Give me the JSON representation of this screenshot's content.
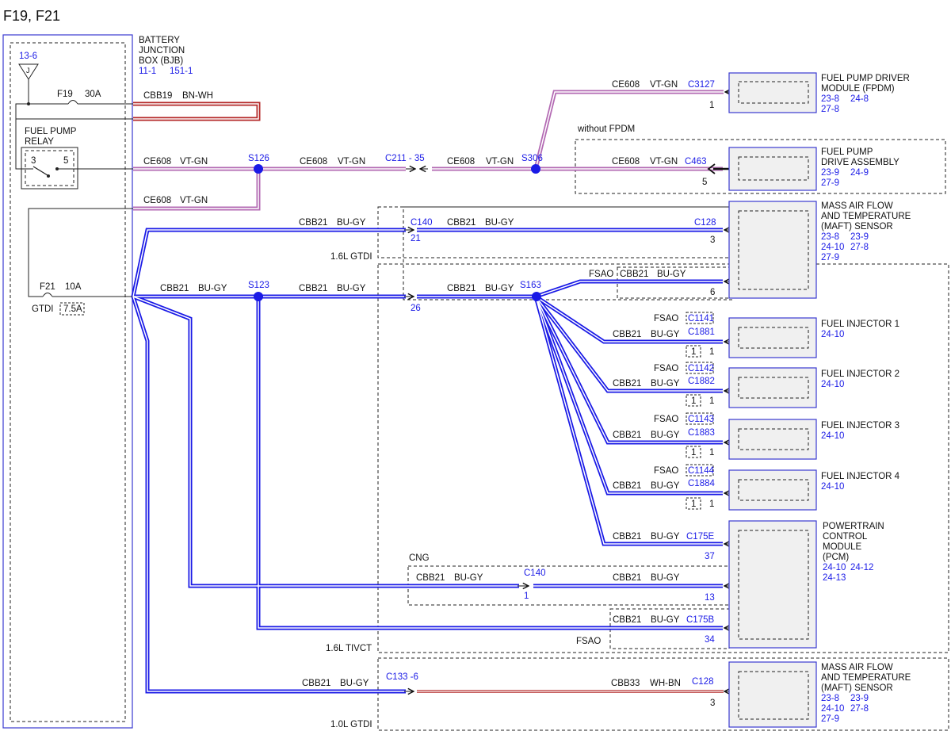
{
  "page": {
    "title": "F19, F21"
  },
  "bjb": {
    "label_1": "BATTERY",
    "label_2": "JUNCTION",
    "label_3": "BOX (BJB)",
    "ref_1": "11-1",
    "ref_2": "151-1",
    "power_ref": "13-6",
    "ground_symbol": "J",
    "fuse_f19": "F19",
    "fuse_f19_rating": "30A",
    "fuse_f21": "F21",
    "fuse_f21_rating": "10A",
    "gtdi": "GTDI",
    "alt_rating": "7.5A"
  },
  "relay": {
    "label_1": "FUEL PUMP",
    "label_2": "RELAY",
    "pin_3": "3",
    "pin_5": "5"
  },
  "wires": {
    "cbb19": "CBB19",
    "bn_wh": "BN-WH",
    "ce608": "CE608",
    "vt_gn": "VT-GN",
    "cbb21": "CBB21",
    "bu_gy": "BU-GY",
    "cbb33": "CBB33",
    "wh_bn": "WH-BN"
  },
  "splices": {
    "s126": "S126",
    "s306": "S306",
    "s123": "S123",
    "s163": "S163"
  },
  "connectors": {
    "c211": "C211 - 35",
    "c3127": "C3127",
    "c463": "C463",
    "c140": "C140",
    "c128": "C128",
    "c133": "C133 -6",
    "c175e": "C175E",
    "c175b": "C175B",
    "c1141": "C1141",
    "c1881": "C1881",
    "c1142": "C1142",
    "c1882": "C1882",
    "c1143": "C1143",
    "c1883": "C1883",
    "c1144": "C1144",
    "c1884": "C1884"
  },
  "pins": {
    "p1": "1",
    "p5": "5",
    "p21": "21",
    "p26": "26",
    "p3": "3",
    "p6": "6",
    "p37": "37",
    "p13": "13",
    "p34": "34"
  },
  "options": {
    "without_fpdm": "without FPDM",
    "gtdi_16": "1.6L GTDI",
    "tivct_16": "1.6L TIVCT",
    "gtdi_10": "1.0L GTDI",
    "cng": "CNG",
    "fsao": "FSAO"
  },
  "components": {
    "fpdm": {
      "line_1": "FUEL PUMP DRIVER",
      "line_2": "MODULE (FPDM)",
      "ref_1": "23-8",
      "ref_2": "24-8",
      "ref_3": "27-8"
    },
    "fpda": {
      "line_1": "FUEL PUMP",
      "line_2": "DRIVE ASSEMBLY",
      "ref_1": "23-9",
      "ref_2": "24-9",
      "ref_3": "27-9"
    },
    "maft": {
      "line_1": "MASS AIR FLOW",
      "line_2": "AND TEMPERATURE",
      "line_3": "(MAFT) SENSOR",
      "ref_1": "23-8",
      "ref_2": "23-9",
      "ref_3": "24-10",
      "ref_4": "27-8",
      "ref_5": "27-9"
    },
    "inj1": {
      "line_1": "FUEL INJECTOR 1",
      "ref": "24-10"
    },
    "inj2": {
      "line_1": "FUEL INJECTOR 2",
      "ref": "24-10"
    },
    "inj3": {
      "line_1": "FUEL INJECTOR 3",
      "ref": "24-10"
    },
    "inj4": {
      "line_1": "FUEL INJECTOR 4",
      "ref": "24-10"
    },
    "pcm": {
      "line_1": "POWERTRAIN",
      "line_2": "CONTROL",
      "line_3": "MODULE",
      "line_4": "(PCM)",
      "ref_1": "24-10",
      "ref_2": "24-12",
      "ref_3": "24-13"
    }
  },
  "colors": {
    "blue_wire": "#1a1ae6",
    "violet_wire": "#b36ab3",
    "brown_wire": "#b42a2a",
    "component_fill": "#f0f0f0",
    "frame": "#3a3ad0"
  }
}
